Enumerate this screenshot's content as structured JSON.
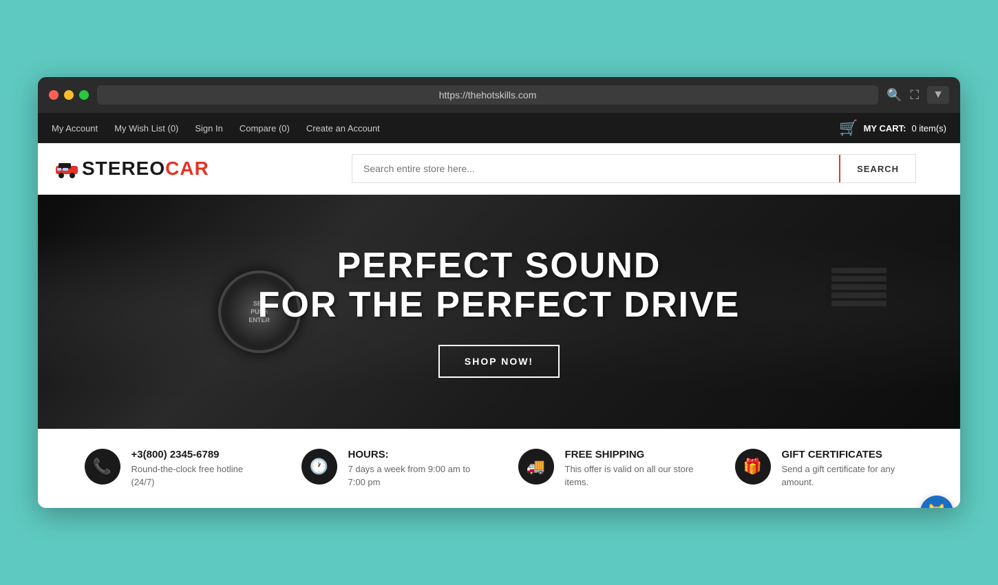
{
  "browser": {
    "url": "https://thehotskills.com",
    "search_icon": "🔍",
    "expand_icon": "⛶",
    "dropdown_icon": "▼"
  },
  "topnav": {
    "links": [
      {
        "label": "My Account",
        "id": "my-account"
      },
      {
        "label": "My Wish List (0)",
        "id": "wishlist"
      },
      {
        "label": "Sign In",
        "id": "sign-in"
      },
      {
        "label": "Compare (0)",
        "id": "compare"
      },
      {
        "label": "Create an Account",
        "id": "create-account"
      }
    ],
    "cart": {
      "label": "MY CART:",
      "count": "0 item(s)"
    }
  },
  "header": {
    "logo": {
      "stereo": "STEREO",
      "car": "CAR"
    },
    "search": {
      "placeholder": "Search entire store here...",
      "button_label": "SEARCH"
    }
  },
  "hero": {
    "line1": "PERFECT SOUND",
    "line2": "FOR THE PERFECT DRIVE",
    "button_label": "SHOP NOW!",
    "dial_lines": [
      "SEL",
      "PUSH",
      "ENTER"
    ]
  },
  "features": [
    {
      "icon": "📞",
      "title": "+3(800) 2345-6789",
      "desc": "Round-the-clock free hotline (24/7)"
    },
    {
      "icon": "🕐",
      "title": "HOURS:",
      "desc": "7 days a week from 9:00 am to 7:00 pm"
    },
    {
      "icon": "🚚",
      "title": "FREE SHIPPING",
      "desc": "This offer is valid on all our store items."
    },
    {
      "icon": "🎁",
      "title": "GIFT CERTIFICATES",
      "desc": "Send a gift certificate for any amount."
    }
  ]
}
